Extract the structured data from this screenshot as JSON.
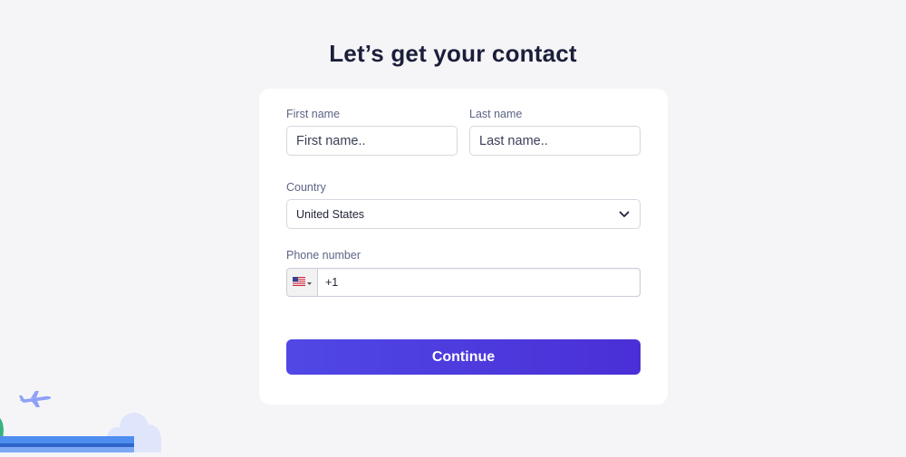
{
  "page": {
    "title": "Let’s get your contact"
  },
  "form": {
    "first_name": {
      "label": "First name",
      "placeholder": "First name..",
      "value": ""
    },
    "last_name": {
      "label": "Last name",
      "placeholder": "Last name..",
      "value": ""
    },
    "country": {
      "label": "Country",
      "selected": "United States",
      "chevron_icon": "chevron-down-icon"
    },
    "phone": {
      "label": "Phone number",
      "flag_icon": "us-flag-icon",
      "value": "+1"
    },
    "continue_label": "Continue"
  },
  "colors": {
    "background": "#f5f5f8",
    "card": "#ffffff",
    "title": "#1c1f3a",
    "label": "#5d6486",
    "button_start": "#5048e5",
    "button_end": "#4a2fd6",
    "decor_plane": "#8ea2f5",
    "decor_cloud": "#dfe5fb",
    "decor_platform": "#4f8df0"
  },
  "decor": {
    "airplane_icon": "airplane-icon",
    "cloud_icon": "cloud-icon"
  }
}
